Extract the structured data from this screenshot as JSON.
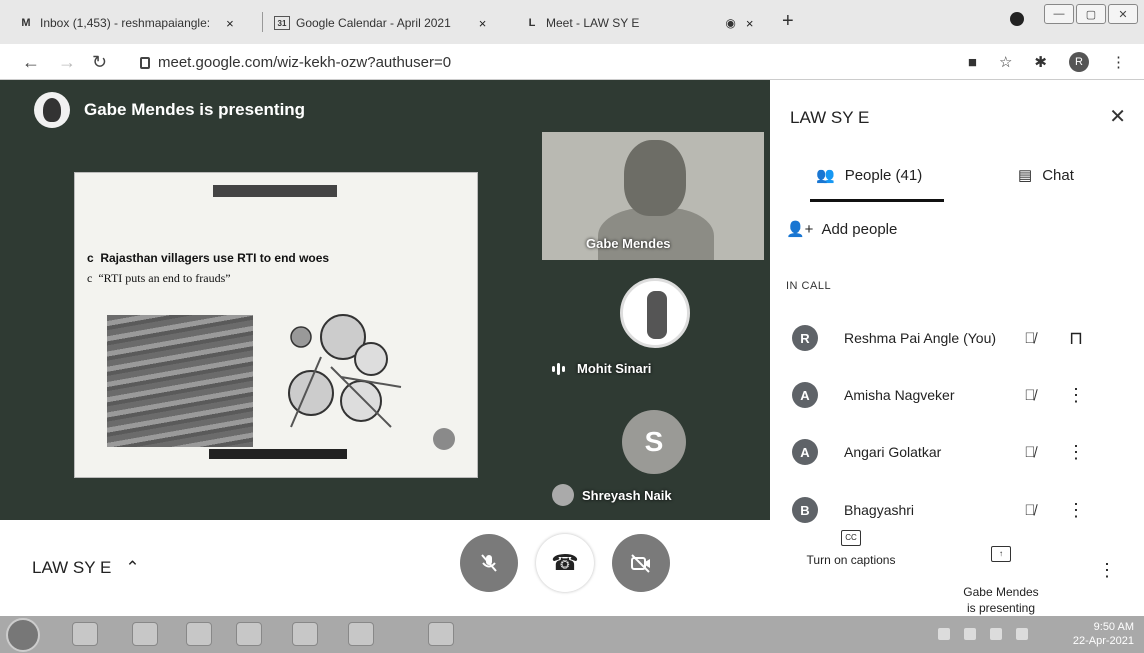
{
  "browser": {
    "tabs": [
      {
        "icon": "gmail-icon",
        "label": "Inbox (1,453) - reshmapaiangle:"
      },
      {
        "icon": "calendar-icon",
        "label": "Google Calendar - April 2021"
      },
      {
        "icon": "meet-icon",
        "label": "Meet - LAW SY E"
      }
    ],
    "url": "meet.google.com/wiz-kekh-ozw?authuser=0",
    "profile_initial": "R"
  },
  "stage": {
    "presenter_banner": "Gabe Mendes is presenting",
    "slide": {
      "bullet_1": "Rajasthan villagers use RTI to end woes",
      "bullet_2": "“RTI puts an end to frauds”"
    },
    "tiles": {
      "gabe": "Gabe Mendes",
      "mohit": "Mohit Sinari",
      "shreyash": "Shreyash Naik",
      "shreyash_initial": "S"
    }
  },
  "callbar": {
    "meeting_name": "LAW SY E"
  },
  "panel": {
    "title": "LAW SY E",
    "people_tab": "People (41)",
    "chat_tab": "Chat",
    "add_people": "Add people",
    "section_label": "IN CALL",
    "participants": [
      {
        "initial": "R",
        "name": "Reshma Pai Angle (You)"
      },
      {
        "initial": "A",
        "name": "Amisha Nagveker"
      },
      {
        "initial": "A",
        "name": "Angari Golatkar"
      },
      {
        "initial": "B",
        "name": "Bhagyashri"
      }
    ],
    "captions_label": "Turn on captions",
    "presenting_label": "Gabe Mendes\nis presenting"
  },
  "taskbar": {
    "time": "9:50 AM",
    "date": "22-Apr-2021"
  },
  "colors": {
    "stage_bg": "#2f3a33",
    "panel_bg": "#ffffff",
    "taskbar_bg": "#a9a9a9"
  }
}
